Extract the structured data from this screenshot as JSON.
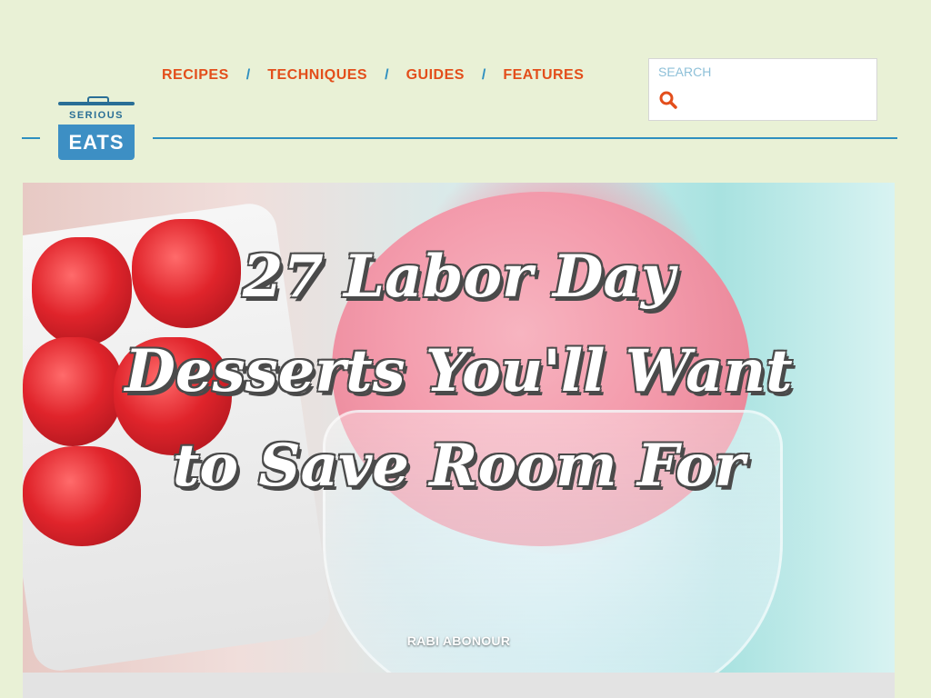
{
  "logo": {
    "top": "SERIOUS",
    "bottom": "EATS"
  },
  "nav": {
    "items": [
      "RECIPES",
      "TECHNIQUES",
      "GUIDES",
      "FEATURES"
    ],
    "separator": "/"
  },
  "search": {
    "label": "SEARCH",
    "placeholder": ""
  },
  "hero": {
    "title": "27 Labor Day Desserts You'll Want to Save Room For",
    "author": "RABI ABONOUR"
  },
  "colors": {
    "background": "#e9f1d6",
    "nav_link": "#e34e1b",
    "accent_blue": "#2e8fc0",
    "logo_blue": "#3d8fc4"
  },
  "icons": {
    "search": "search-icon"
  }
}
